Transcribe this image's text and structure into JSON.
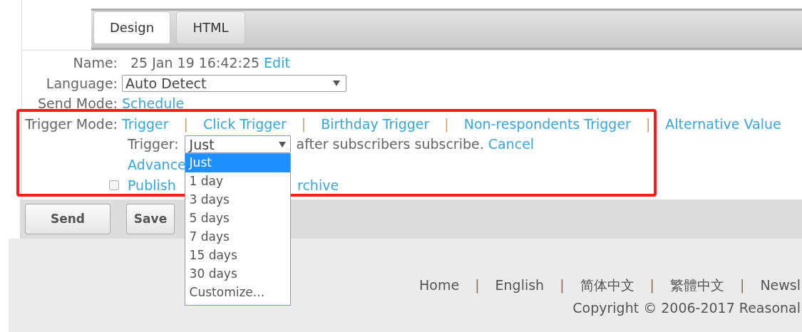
{
  "tabs": [
    {
      "label": "Design",
      "selected": true
    },
    {
      "label": "HTML",
      "selected": false
    }
  ],
  "form": {
    "name": {
      "label": "Name:",
      "value": "25 Jan 19 16:42:25",
      "link": "Edit"
    },
    "language": {
      "label": "Language:",
      "value": "Auto Detect"
    },
    "send_mode": {
      "label": "Send Mode:",
      "link": "Schedule"
    },
    "trigger_mode": {
      "label": "Trigger Mode:",
      "items": [
        {
          "kind": "link",
          "text": "Trigger"
        },
        {
          "kind": "separator",
          "text": "|"
        },
        {
          "kind": "link",
          "text": "Click Trigger"
        },
        {
          "kind": "separator",
          "text": "|"
        },
        {
          "kind": "link",
          "text": "Birthday Trigger"
        },
        {
          "kind": "separator",
          "text": "|"
        },
        {
          "kind": "link",
          "text": "Non-respondents Trigger"
        },
        {
          "kind": "separator",
          "text": "|"
        },
        {
          "kind": "link",
          "text": "Alternative Value"
        }
      ]
    },
    "trigger": {
      "label": "Trigger:",
      "value": "Just",
      "expanded": true,
      "suffix": "after subscribers subscribe.",
      "cancel": "Cancel",
      "options": [
        {
          "label": "Just",
          "selected": true
        },
        {
          "label": "1 day",
          "selected": false
        },
        {
          "label": "3 days",
          "selected": false
        },
        {
          "label": "5 days",
          "selected": false
        },
        {
          "label": "7 days",
          "selected": false
        },
        {
          "label": "15 days",
          "selected": false
        },
        {
          "label": "30 days",
          "selected": false
        },
        {
          "label": "Customize...",
          "selected": false
        }
      ]
    },
    "advanced": {
      "link": "Advance"
    },
    "publish": {
      "checked": false,
      "text_before": "Publish",
      "text_after": "rchive"
    }
  },
  "buttons": [
    "Send",
    "Save"
  ],
  "footer": {
    "items": [
      {
        "kind": "link",
        "text": "Home"
      },
      {
        "kind": "separator",
        "text": "|"
      },
      {
        "kind": "link",
        "text": "English"
      },
      {
        "kind": "separator",
        "text": "|"
      },
      {
        "kind": "link",
        "text": "简体中文"
      },
      {
        "kind": "separator",
        "text": "|"
      },
      {
        "kind": "link",
        "text": "繁體中文"
      },
      {
        "kind": "separator",
        "text": "|"
      },
      {
        "kind": "link",
        "text": "Newsl"
      }
    ],
    "copyright": "Copyright © 2006-2017 Reasonal"
  }
}
